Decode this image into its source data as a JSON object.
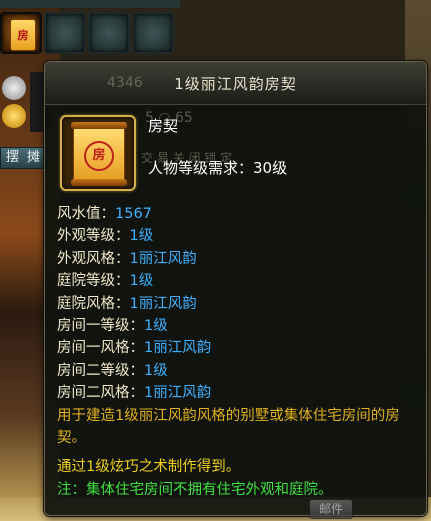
{
  "slots": {
    "selected_icon_char": "房"
  },
  "side": {
    "stall_button": "摆 摊"
  },
  "tooltip": {
    "title": "1级丽江风韵房契",
    "ghost_number": "4346",
    "ghost_values": "5 ○ 65",
    "ghost_buttons": "交  易  关  闭  锁  定",
    "icon_seal": "房",
    "item_name": "房契",
    "requirement": "人物等级需求：30级",
    "attributes": [
      {
        "key": "风水值：",
        "value": "1567"
      },
      {
        "key": "外观等级：",
        "value": "1级"
      },
      {
        "key": "外观风格：",
        "value": "1丽江风韵"
      },
      {
        "key": "庭院等级：",
        "value": "1级"
      },
      {
        "key": "庭院风格：",
        "value": "1丽江风韵"
      },
      {
        "key": "房间一等级：",
        "value": "1级"
      },
      {
        "key": "房间一风格：",
        "value": "1丽江风韵"
      },
      {
        "key": "房间二等级：",
        "value": "1级"
      },
      {
        "key": "房间二风格：",
        "value": "1丽江风韵"
      }
    ],
    "description": "用于建造1级丽江风韵风格的别墅或集体住宅房间的房契。",
    "source": "通过1级炫巧之术制作得到。",
    "note": "注：集体住宅房间不拥有住宅外观和庭院。"
  },
  "mail_button": "邮件"
}
